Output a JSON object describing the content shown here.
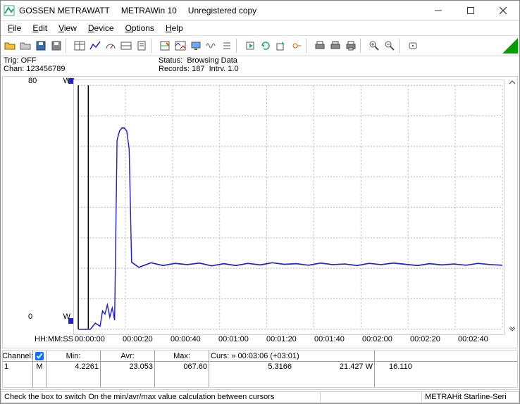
{
  "title": {
    "brand": "GOSSEN METRAWATT",
    "app": "METRAWin 10",
    "note": "Unregistered copy"
  },
  "menu": {
    "items": [
      "File",
      "Edit",
      "View",
      "Device",
      "Options",
      "Help"
    ]
  },
  "toolbar": {
    "items": [
      {
        "name": "open-file-icon"
      },
      {
        "name": "open-gray-icon"
      },
      {
        "name": "save-icon"
      },
      {
        "name": "save-alt-icon"
      },
      {
        "sep": true
      },
      {
        "name": "table-icon"
      },
      {
        "name": "chart-icon"
      },
      {
        "name": "gauge-icon"
      },
      {
        "name": "panel-icon"
      },
      {
        "name": "notes-icon"
      },
      {
        "sep": true
      },
      {
        "name": "grid-pen-icon"
      },
      {
        "name": "dual-chart-icon"
      },
      {
        "name": "monitor-icon"
      },
      {
        "name": "wave-icon"
      },
      {
        "name": "list-icon"
      },
      {
        "sep": true
      },
      {
        "name": "playlist-icon"
      },
      {
        "name": "refresh-icon"
      },
      {
        "name": "export-icon"
      },
      {
        "name": "deg-icon"
      },
      {
        "sep": true
      },
      {
        "name": "printer1-icon"
      },
      {
        "name": "printer2-icon"
      },
      {
        "name": "printer3-icon"
      },
      {
        "sep": true
      },
      {
        "name": "zoom-in-icon"
      },
      {
        "name": "zoom-out-icon"
      },
      {
        "sep": true
      },
      {
        "name": "info-icon"
      }
    ]
  },
  "info": {
    "trig_label": "Trig:",
    "trig_value": "OFF",
    "chan_label": "Chan:",
    "chan_value": "123456789",
    "status_label": "Status:",
    "status_value": "Browsing Data",
    "records_label": "Records:",
    "records_value": "187",
    "intrv_label": "Intrv.",
    "intrv_value": "1.0"
  },
  "plot": {
    "ymax": "80",
    "ymin": "0",
    "yunit": "W",
    "xlabel": "HH:MM:SS",
    "xticks": [
      "00:00:00",
      "00:00:20",
      "00:00:40",
      "00:01:00",
      "00:01:20",
      "00:01:40",
      "00:02:00",
      "00:02:20",
      "00:02:40"
    ]
  },
  "chart_data": {
    "type": "line",
    "title": "",
    "xlabel": "HH:MM:SS",
    "ylabel": "W",
    "ylim": [
      0,
      80
    ],
    "xlim": [
      0,
      175
    ],
    "series": [
      {
        "name": "M",
        "x": [
          0,
          5,
          7,
          9,
          10,
          11,
          12,
          13,
          14,
          15,
          16,
          17,
          18,
          19,
          20,
          21,
          22,
          25,
          30,
          35,
          40,
          45,
          50,
          55,
          60,
          65,
          70,
          75,
          80,
          85,
          90,
          95,
          100,
          105,
          110,
          115,
          120,
          125,
          130,
          135,
          140,
          145,
          150,
          155,
          160,
          165,
          170,
          175
        ],
        "y": [
          0,
          0,
          2,
          1,
          6,
          5,
          8,
          4,
          7,
          3,
          62,
          65,
          66,
          66,
          65,
          59,
          22,
          20.3,
          21.8,
          20.9,
          21.6,
          21.2,
          21.7,
          20.8,
          21.5,
          20.9,
          21.6,
          21.1,
          21.8,
          21.3,
          21.5,
          21.0,
          21.7,
          21.2,
          21.4,
          20.9,
          21.6,
          21.2,
          21.7,
          21.3,
          20.9,
          21.5,
          21.1,
          21.4,
          21.0,
          21.6,
          21.2,
          21.0
        ]
      }
    ]
  },
  "table": {
    "head": {
      "channel": "Channel:",
      "min": "Min:",
      "avr": "Avr:",
      "max": "Max:",
      "curs": "Curs: » 00:03:06 (+03:01)"
    },
    "row": {
      "idx": "1",
      "mode": "M",
      "min": "4.2261",
      "avr": "23.053",
      "max": "067.60",
      "c1": "5.3166",
      "c2": "21.427  W",
      "c3": "16.110"
    }
  },
  "footer": {
    "hint": "Check the box to switch On the min/avr/max value calculation between cursors",
    "device": "METRAHit Starline-Seri"
  }
}
